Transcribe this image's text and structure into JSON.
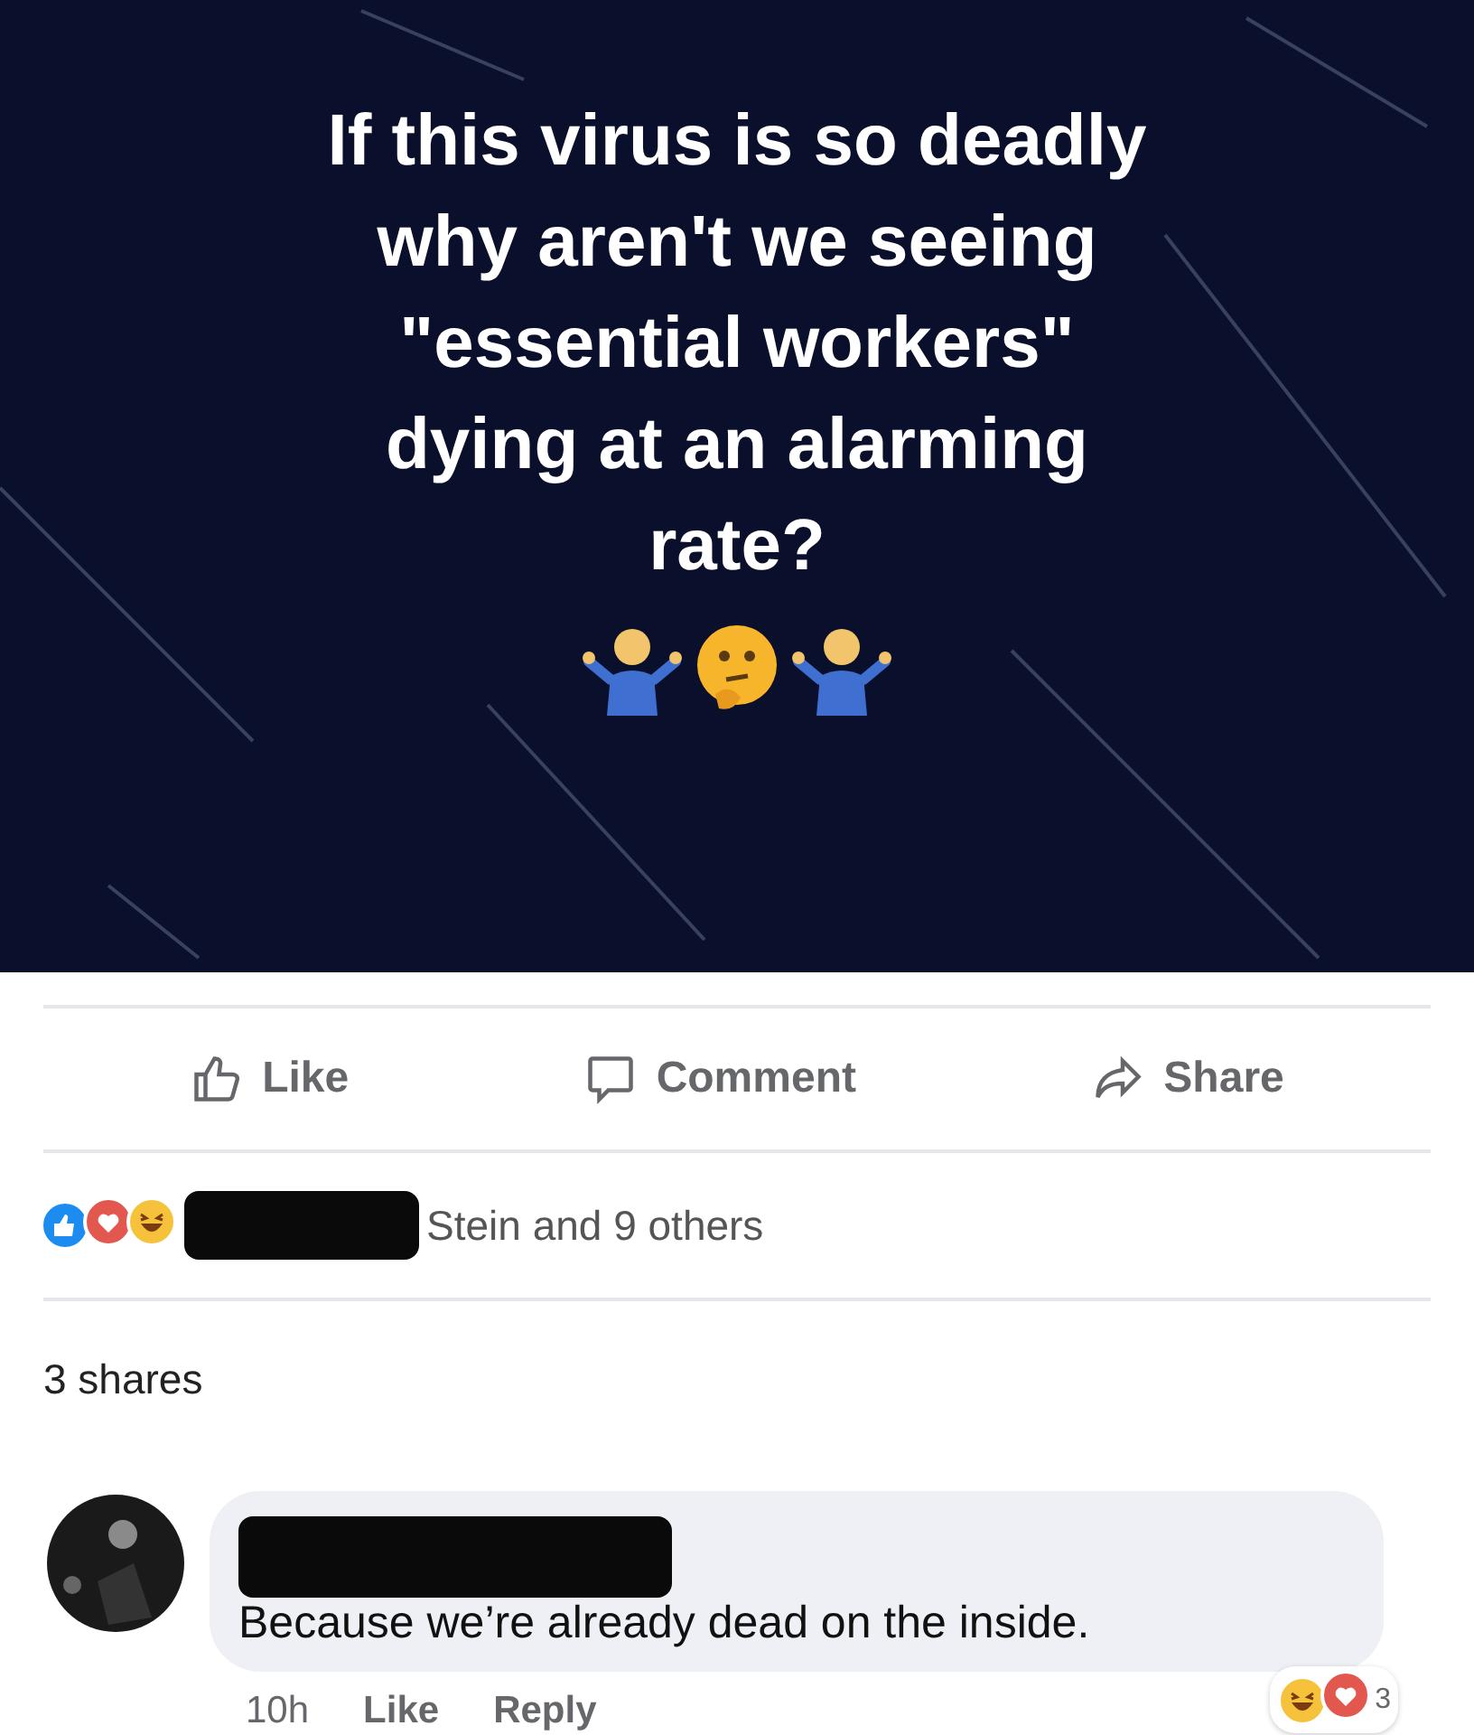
{
  "post_image": {
    "text": "If this virus is so deadly\nwhy aren't we seeing\n\"essential workers\"\ndying at an alarming\nrate?"
  },
  "actions": [
    {
      "kind": "like",
      "label": "Like"
    },
    {
      "kind": "comment",
      "label": "Comment"
    },
    {
      "kind": "share",
      "label": "Share"
    }
  ],
  "reactions": {
    "names": "Stein and 9 others"
  },
  "shares": "3 shares",
  "comment": {
    "text": "Because we’re already dead on the inside.",
    "time": "10h",
    "actions": [
      "Like",
      "Reply"
    ],
    "reaction_count": "3"
  }
}
